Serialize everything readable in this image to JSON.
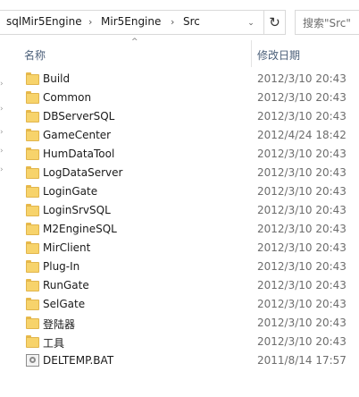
{
  "address": {
    "segments": [
      "sqlMir5Engine",
      "Mir5Engine",
      "Src"
    ],
    "separator_glyph": "›",
    "dropdown_glyph": "⌄",
    "refresh_glyph": "↻"
  },
  "search": {
    "placeholder": "搜索\"Src\""
  },
  "columns": {
    "name": "名称",
    "date_modified": "修改日期",
    "sort_glyph": "^"
  },
  "nav": {
    "chevron_glyph": "›"
  },
  "files": [
    {
      "name": "Build",
      "date": "2012/3/10 20:43",
      "icon": "folder-icon"
    },
    {
      "name": "Common",
      "date": "2012/3/10 20:43",
      "icon": "folder-icon"
    },
    {
      "name": "DBServerSQL",
      "date": "2012/3/10 20:43",
      "icon": "folder-icon"
    },
    {
      "name": "GameCenter",
      "date": "2012/4/24 18:42",
      "icon": "folder-icon"
    },
    {
      "name": "HumDataTool",
      "date": "2012/3/10 20:43",
      "icon": "folder-icon"
    },
    {
      "name": "LogDataServer",
      "date": "2012/3/10 20:43",
      "icon": "folder-icon"
    },
    {
      "name": "LoginGate",
      "date": "2012/3/10 20:43",
      "icon": "folder-icon"
    },
    {
      "name": "LoginSrvSQL",
      "date": "2012/3/10 20:43",
      "icon": "folder-icon"
    },
    {
      "name": "M2EngineSQL",
      "date": "2012/3/10 20:43",
      "icon": "folder-icon"
    },
    {
      "name": "MirClient",
      "date": "2012/3/10 20:43",
      "icon": "folder-icon"
    },
    {
      "name": "Plug-In",
      "date": "2012/3/10 20:43",
      "icon": "folder-icon"
    },
    {
      "name": "RunGate",
      "date": "2012/3/10 20:43",
      "icon": "folder-icon"
    },
    {
      "name": "SelGate",
      "date": "2012/3/10 20:43",
      "icon": "folder-icon"
    },
    {
      "name": "登陆器",
      "date": "2012/3/10 20:43",
      "icon": "folder-icon"
    },
    {
      "name": "工具",
      "date": "2012/3/10 20:43",
      "icon": "folder-icon"
    },
    {
      "name": "DELTEMP.BAT",
      "date": "2011/8/14 17:57",
      "icon": "bat-file-icon"
    }
  ]
}
